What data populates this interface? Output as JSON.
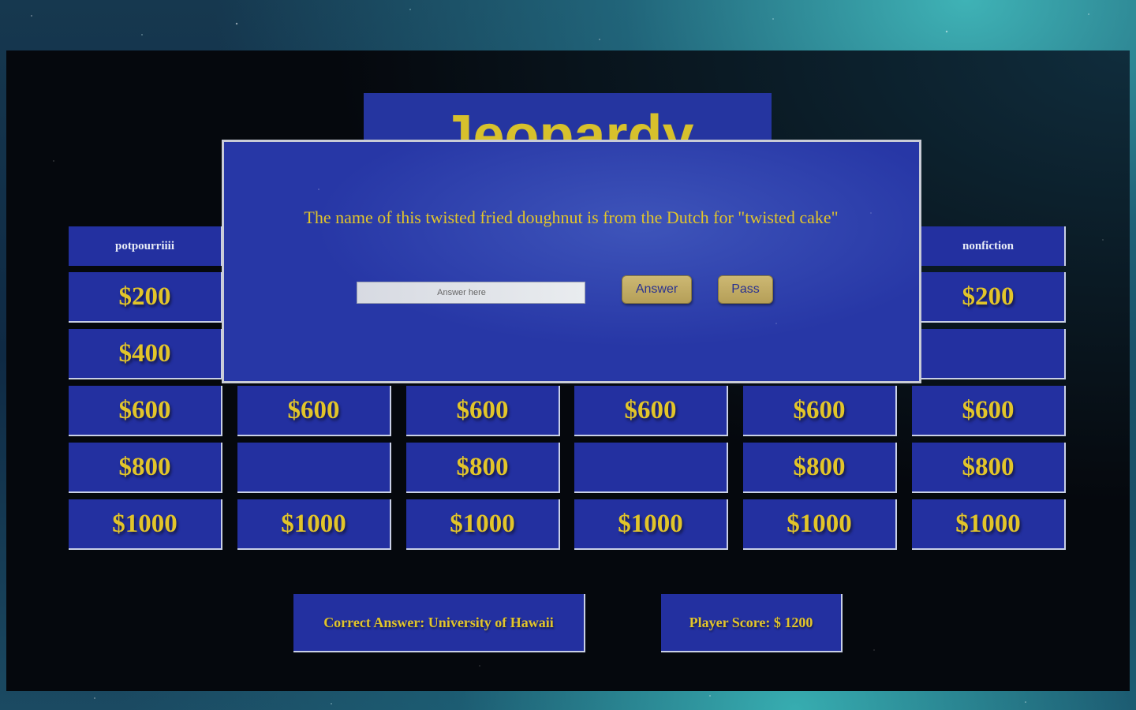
{
  "app": {
    "title": "Jeopardy"
  },
  "board": {
    "categories": [
      {
        "label": "potpourriiii"
      },
      {
        "label": ""
      },
      {
        "label": ""
      },
      {
        "label": ""
      },
      {
        "label": ""
      },
      {
        "label": "nonfiction"
      }
    ],
    "rows": [
      [
        "$200",
        "",
        "",
        "",
        "",
        "$200"
      ],
      [
        "$400",
        "",
        "",
        "",
        "",
        ""
      ],
      [
        "$600",
        "$600",
        "$600",
        "$600",
        "$600",
        "$600"
      ],
      [
        "$800",
        "",
        "$800",
        "",
        "$800",
        "$800"
      ],
      [
        "$1000",
        "$1000",
        "$1000",
        "$1000",
        "$1000",
        "$1000"
      ]
    ]
  },
  "status": {
    "correct_answer": "Correct Answer: University of Hawaii",
    "player_score": "Player Score: $ 1200"
  },
  "modal": {
    "question": "The name of this twisted fried doughnut is from the Dutch for \"twisted cake\"",
    "input_placeholder": "Answer here",
    "input_value": "",
    "answer_label": "Answer",
    "pass_label": "Pass"
  },
  "colors": {
    "tile_blue": "#2330a0",
    "gold_text": "#e2c52a",
    "button_gold": "#c2ac63"
  }
}
